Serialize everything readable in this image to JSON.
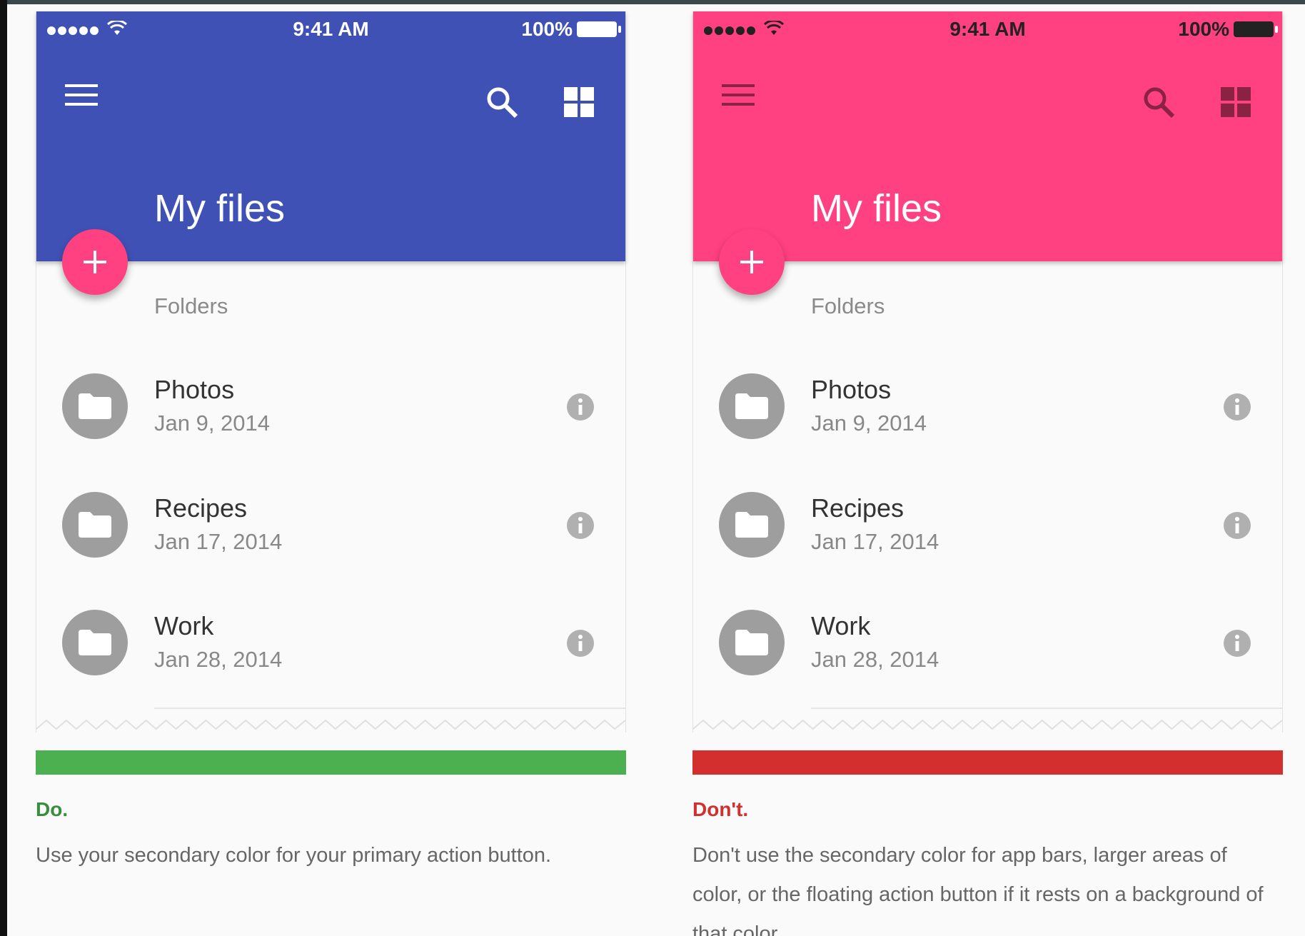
{
  "colors": {
    "do_primary": "#3f51b5",
    "dont_primary": "#ff4081",
    "fab": "#ff4081",
    "do_bar": "#4caf50",
    "dont_bar": "#d32f2f"
  },
  "examples": [
    {
      "status": {
        "time": "9:41 AM",
        "battery": "100%"
      },
      "title": "My files",
      "section": "Folders",
      "items": [
        {
          "name": "Photos",
          "date": "Jan 9, 2014"
        },
        {
          "name": "Recipes",
          "date": "Jan 17, 2014"
        },
        {
          "name": "Work",
          "date": "Jan 28, 2014"
        }
      ],
      "verdict": "Do.",
      "caption": "Use your secondary color for your primary action button."
    },
    {
      "status": {
        "time": "9:41 AM",
        "battery": "100%"
      },
      "title": "My files",
      "section": "Folders",
      "items": [
        {
          "name": "Photos",
          "date": "Jan 9, 2014"
        },
        {
          "name": "Recipes",
          "date": "Jan 17, 2014"
        },
        {
          "name": "Work",
          "date": "Jan 28, 2014"
        }
      ],
      "verdict": "Don't.",
      "caption": "Don't use the secondary color for app bars, larger areas of color, or the floating action button if it rests on a background of that color."
    }
  ],
  "icons": [
    "menu-icon",
    "search-icon",
    "grid-view-icon",
    "add-icon",
    "folder-icon",
    "info-icon",
    "wifi-icon",
    "battery-icon"
  ]
}
